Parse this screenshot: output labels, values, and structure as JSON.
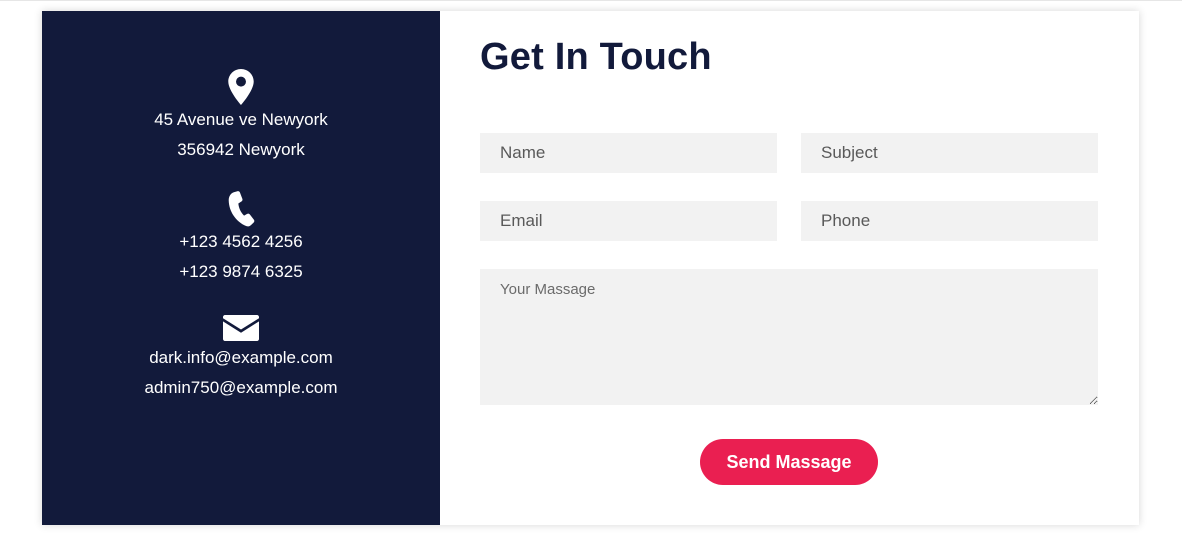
{
  "contact_info": {
    "address": {
      "icon": "map-pin-icon",
      "lines": [
        "45 Avenue ve Newyork",
        "356942 Newyork"
      ]
    },
    "phone": {
      "icon": "phone-icon",
      "lines": [
        "+123 4562 4256",
        "+123 9874 6325"
      ]
    },
    "email": {
      "icon": "envelope-icon",
      "lines": [
        "dark.info@example.com",
        "admin750@example.com"
      ]
    }
  },
  "form": {
    "title": "Get In Touch",
    "name_placeholder": "Name",
    "subject_placeholder": "Subject",
    "email_placeholder": "Email",
    "phone_placeholder": "Phone",
    "message_placeholder": "Your Massage",
    "submit_label": "Send Massage"
  },
  "colors": {
    "panel_bg": "#121a3b",
    "accent": "#ea1f51",
    "field_bg": "#f2f2f2",
    "title": "#121a3b"
  }
}
